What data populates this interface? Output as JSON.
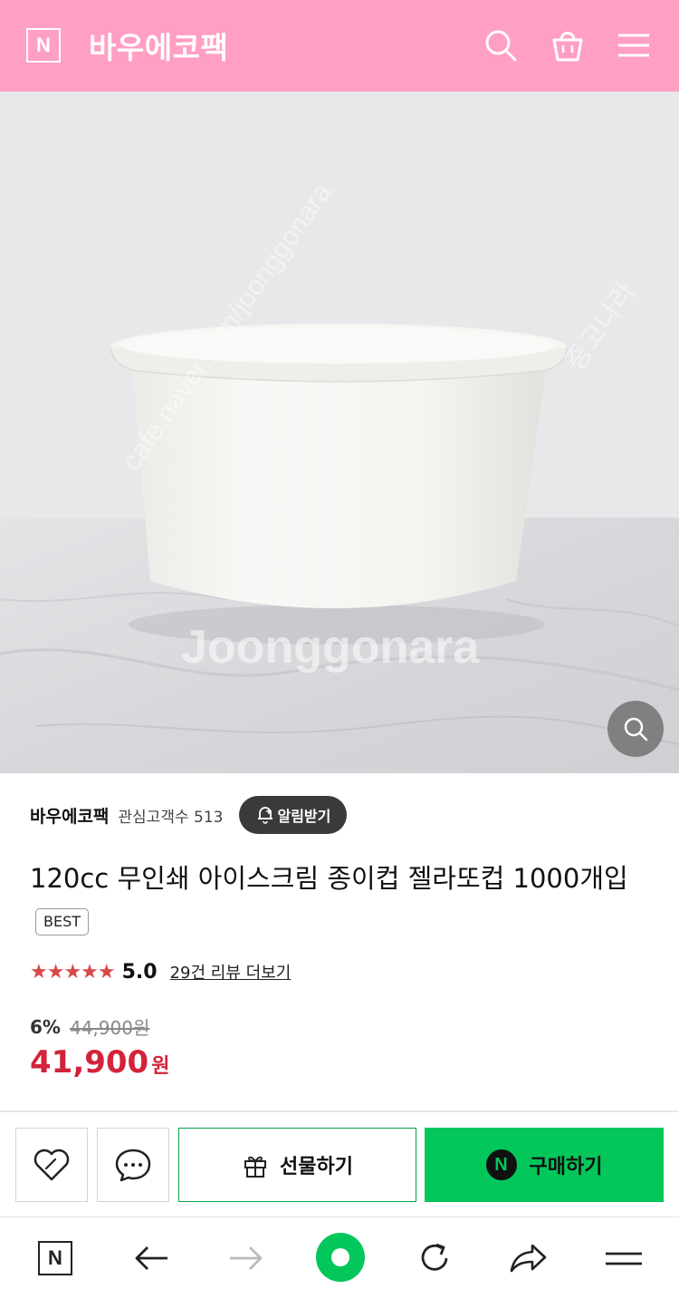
{
  "header": {
    "logo_letter": "N",
    "store_name": "바우에코팩",
    "background_color": "#ff9fc3",
    "icons": [
      "search-icon",
      "shopping-bag-icon",
      "menu-icon"
    ]
  },
  "hero": {
    "watermark_main": "Joonggonara",
    "watermark_diagonal": "cafe.naver.com/joonggonara",
    "watermark_side": "중고나라",
    "zoom_icon": "magnifier-icon"
  },
  "seller": {
    "name": "바우에코팩",
    "interest_label": "관심고객수 513",
    "alarm_button": "알림받기"
  },
  "product": {
    "title": "120cc 무인쇄 아이스크림 종이컵 젤라또컵 1000개입",
    "badge": "BEST",
    "stars": "★★★★★",
    "rating": "5.0",
    "review_link": "29건 리뷰 더보기",
    "discount_rate": "6%",
    "original_price": "44,900원",
    "sale_price": "41,900",
    "sale_unit": "원",
    "price_color": "#d3233a"
  },
  "actions": {
    "wish_icon": "heart-icon",
    "chat_icon": "chat-bubble-icon",
    "gift_label": "선물하기",
    "buy_label": "구매하기",
    "buy_badge_letter": "N",
    "buy_color": "#03c75a"
  },
  "bottom_nav": {
    "logo_letter": "N",
    "icons": [
      "back-arrow-icon",
      "forward-arrow-icon",
      "home-circle-icon",
      "refresh-icon",
      "share-icon",
      "menu-icon"
    ],
    "accent_color": "#03c75a"
  }
}
